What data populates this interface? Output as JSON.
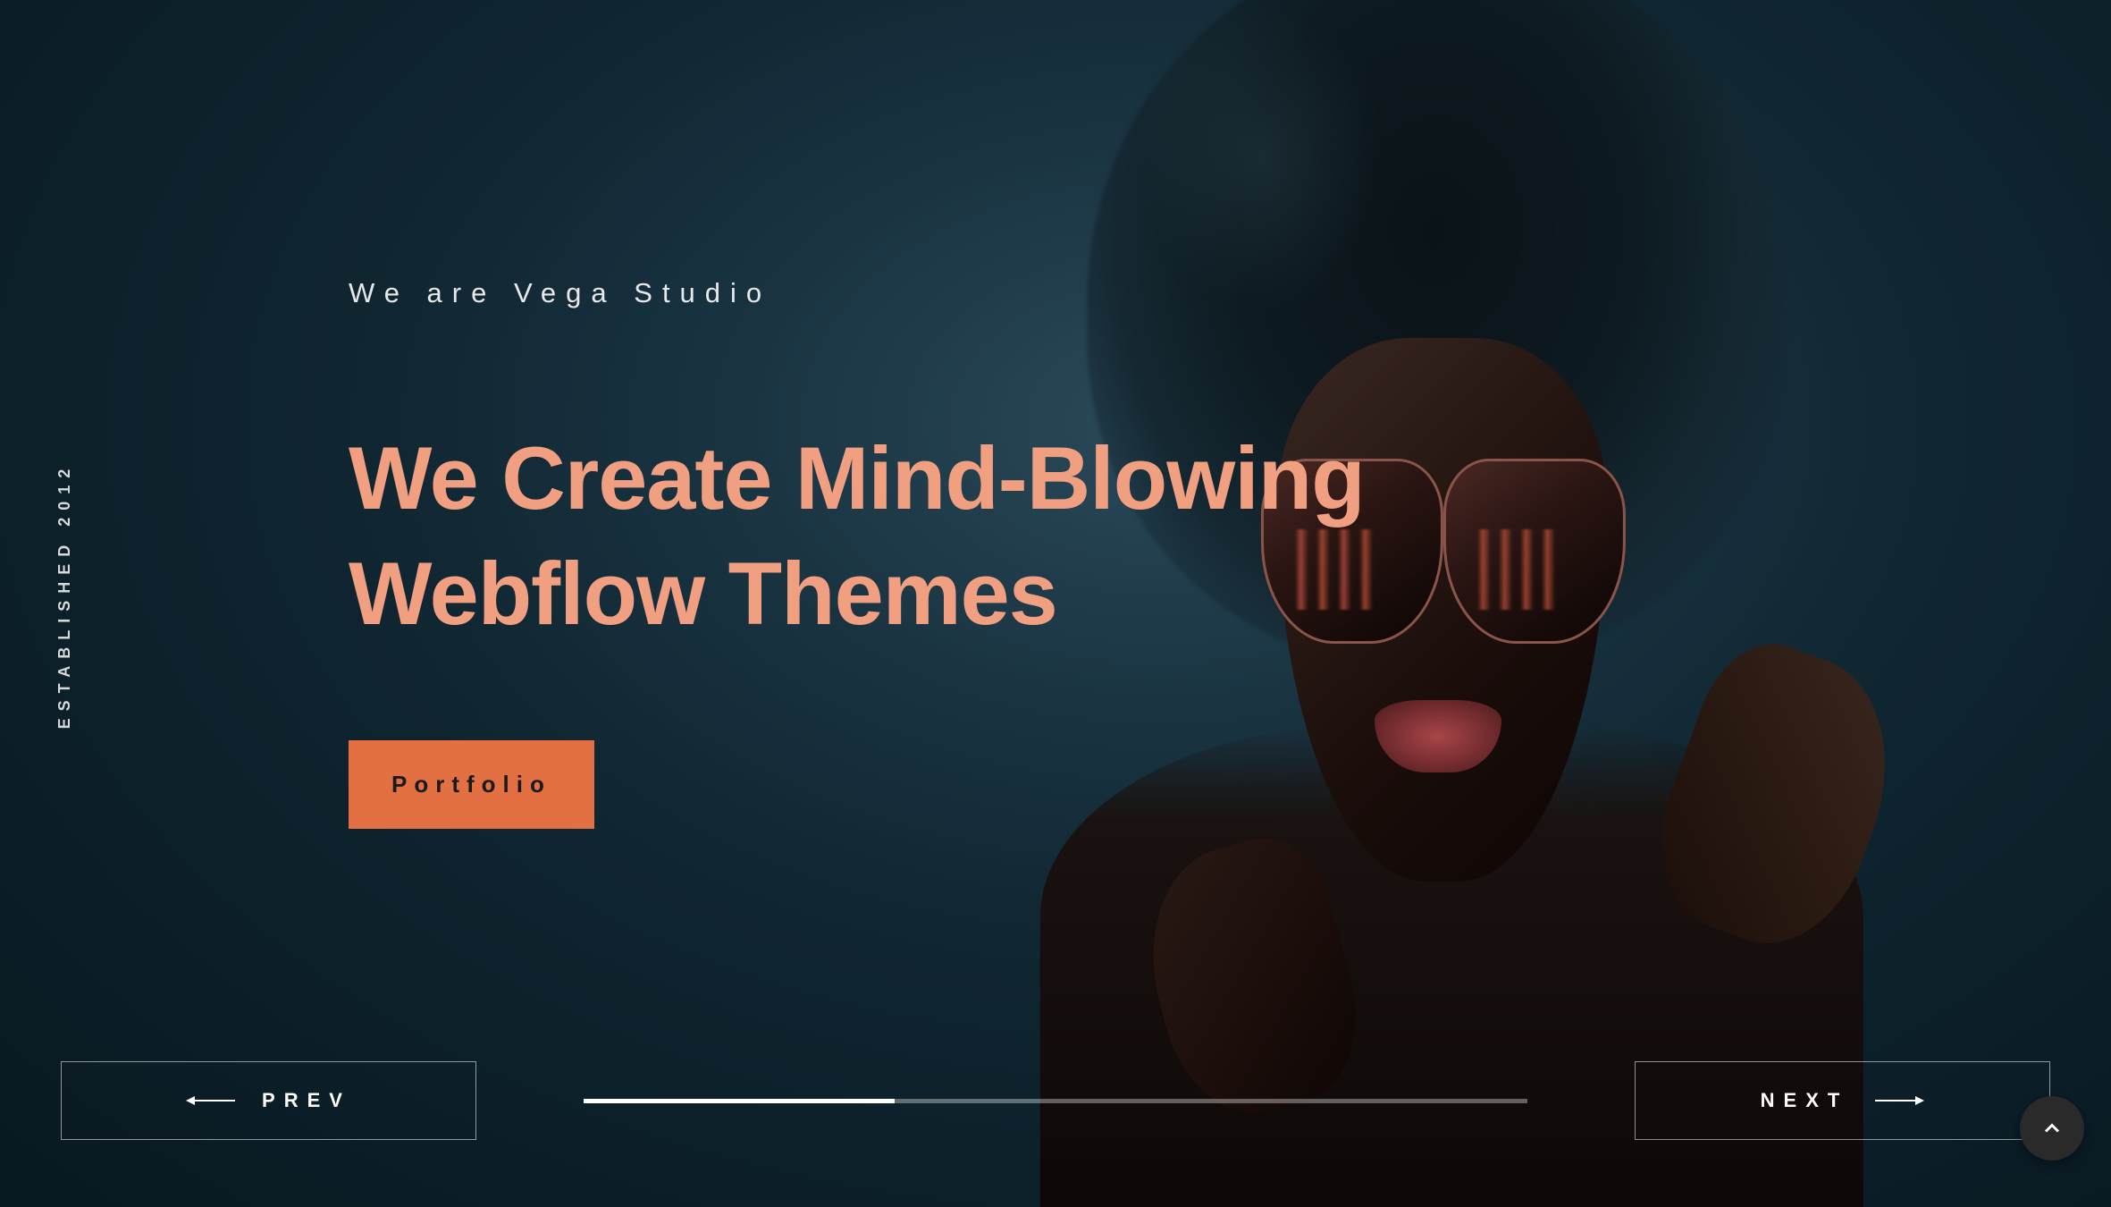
{
  "sidebar": {
    "label": "ESTABLISHED 2012"
  },
  "hero": {
    "tagline": "We are Vega Studio",
    "headline_line1": "We Create Mind-Blowing",
    "headline_line2": "Webflow Themes",
    "cta_label": "Portfolio"
  },
  "slider": {
    "prev_label": "PREV",
    "next_label": "NEXT",
    "progress_percent": 33
  },
  "colors": {
    "accent": "#e27043",
    "headline": "#f0a080"
  }
}
